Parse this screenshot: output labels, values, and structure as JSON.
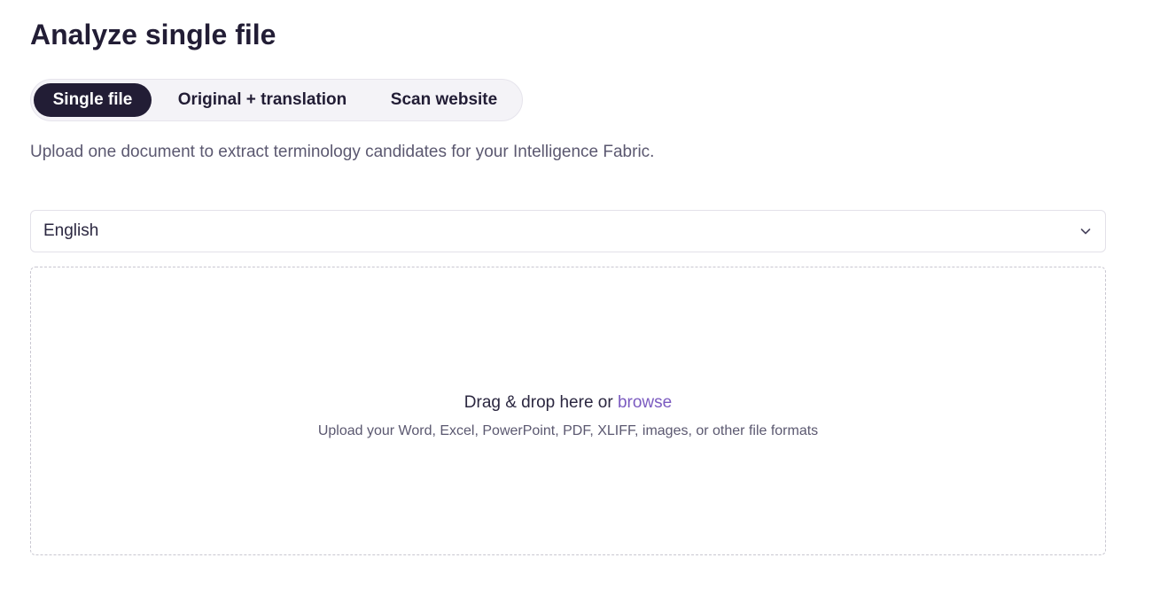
{
  "header": {
    "title": "Analyze single file"
  },
  "mode_tabs": [
    {
      "label": "Single file",
      "active": true
    },
    {
      "label": "Original + translation",
      "active": false
    },
    {
      "label": "Scan website",
      "active": false
    }
  ],
  "subtitle": "Upload one document to extract terminology candidates for your Intelligence Fabric.",
  "language_select": {
    "selected": "English",
    "icon": "chevron-down-icon"
  },
  "dropzone": {
    "prompt_prefix": "Drag & drop here or",
    "browse_label": "browse",
    "hint": "Upload your Word, Excel, PowerPoint, PDF, XLIFF, images, or other file formats"
  },
  "colors": {
    "primary_dark": "#221d35",
    "link": "#7b5bc0",
    "muted_text": "#5b5870"
  }
}
